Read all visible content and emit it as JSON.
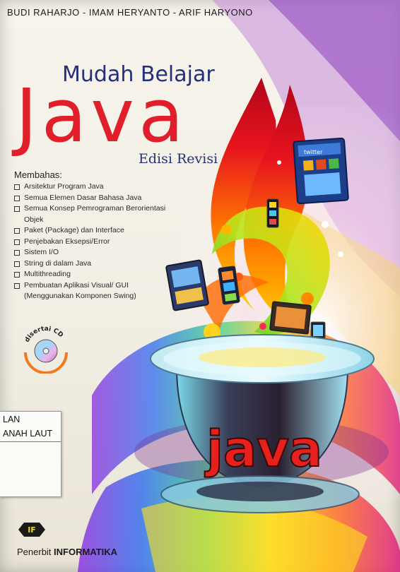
{
  "cover": {
    "authors": "BUDI RAHARJO - IMAM HERYANTO - ARIF HARYONO",
    "title_top": "Mudah Belajar",
    "title_main": "Java",
    "edition": "Edisi Revisi",
    "topics_heading": "Membahas:",
    "topics": [
      "Arsitektur Program Java",
      "Semua Elemen Dasar Bahasa Java",
      "Semua Konsep Pemrograman Berorientasi",
      "Objek",
      "Paket (Package) dan Interface",
      "Penjebakan Eksepsi/Error",
      "Sistem I/O",
      "String di dalam Java",
      "Multithreading",
      "Pembuatan Aplikasi Visual/ GUI",
      "(Menggunakan Komponen Swing)"
    ],
    "cd_badge": "disertai CD",
    "cup_text": "java",
    "phone_app": "twitter"
  },
  "library_label": {
    "line1": "LAN",
    "line2": "ANAH LAUT"
  },
  "publisher": {
    "logo_text": "IF",
    "prefix": "Penerbit",
    "name": "INFORMATIKA"
  },
  "colors": {
    "title_red": "#e01f2b",
    "title_blue": "#23307a"
  }
}
